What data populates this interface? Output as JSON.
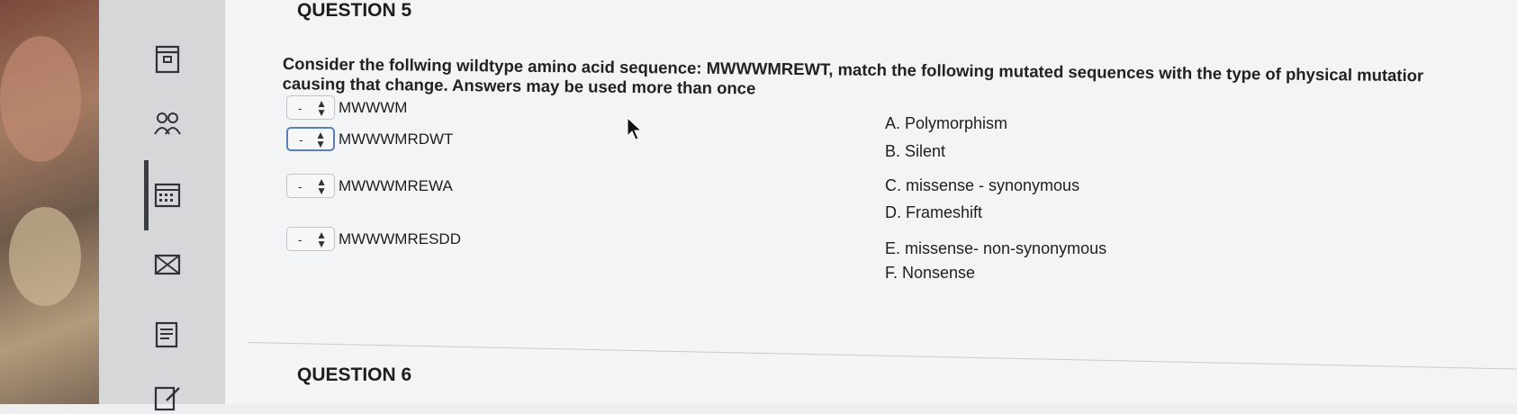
{
  "question5": {
    "title": "QUESTION 5",
    "prompt_line1": "Consider the follwing wildtype amino acid sequence: MWWWMREWT, match the following mutated sequences with the type of physical mutatior",
    "prompt_line2": "causing that change. Answers may be used more than once",
    "items": [
      {
        "select_value": "-",
        "sequence": "MWWWM"
      },
      {
        "select_value": "-",
        "sequence": "MWWWMRDWT"
      },
      {
        "select_value": "-",
        "sequence": "MWWWMREWA"
      },
      {
        "select_value": "-",
        "sequence": "MWWWMRESDD"
      }
    ],
    "options": [
      "A. Polymorphism",
      "B. Silent",
      "C. missense - synonymous",
      "D. Frameshift",
      "E. missense- non-synonymous",
      "F. Nonsense"
    ]
  },
  "question6": {
    "title": "QUESTION 6"
  },
  "icons": [
    "book-icon",
    "people-icon",
    "calendar-icon",
    "mail-icon",
    "notes-icon",
    "edit-icon"
  ]
}
